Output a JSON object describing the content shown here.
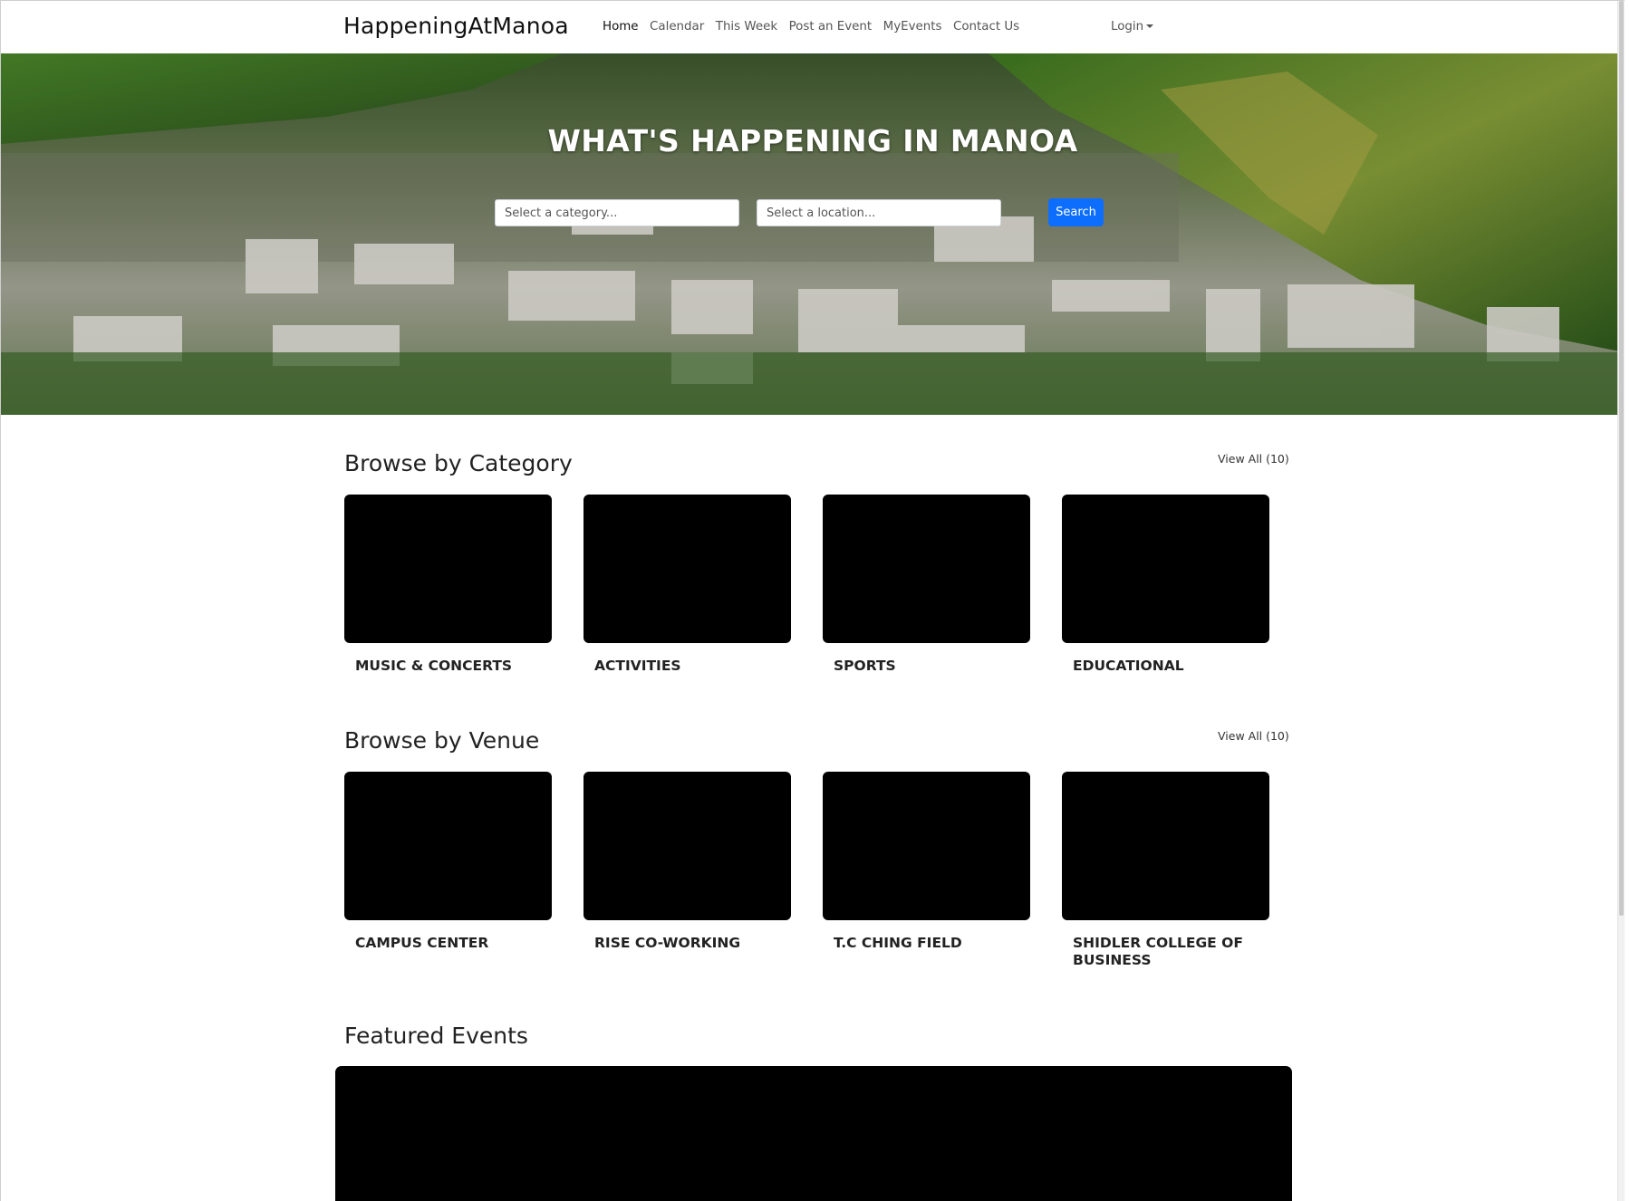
{
  "navbar": {
    "brand": "HappeningAtManoa",
    "links": [
      {
        "label": "Home",
        "active": true
      },
      {
        "label": "Calendar",
        "active": false
      },
      {
        "label": "This Week",
        "active": false
      },
      {
        "label": "Post an Event",
        "active": false
      },
      {
        "label": "MyEvents",
        "active": false
      },
      {
        "label": "Contact Us",
        "active": false
      }
    ],
    "login": "Login"
  },
  "hero": {
    "title": "WHAT'S HAPPENING IN MANOA",
    "category_placeholder": "Select a category...",
    "location_placeholder": "Select a location...",
    "search_label": "Search"
  },
  "categories": {
    "title": "Browse by Category",
    "view_all": "View All (10)",
    "items": [
      {
        "label": "MUSIC & CONCERTS"
      },
      {
        "label": "ACTIVITIES"
      },
      {
        "label": "SPORTS"
      },
      {
        "label": "EDUCATIONAL"
      }
    ]
  },
  "venues": {
    "title": "Browse by Venue",
    "view_all": "View All (10)",
    "items": [
      {
        "label": "CAMPUS CENTER"
      },
      {
        "label": "RISE CO-WORKING"
      },
      {
        "label": "T.C CHING FIELD"
      },
      {
        "label": "SHIDLER COLLEGE OF BUSINESS"
      }
    ]
  },
  "featured": {
    "title": "Featured Events"
  },
  "colors": {
    "accent": "#0d6efd",
    "card_placeholder": "#000000"
  }
}
